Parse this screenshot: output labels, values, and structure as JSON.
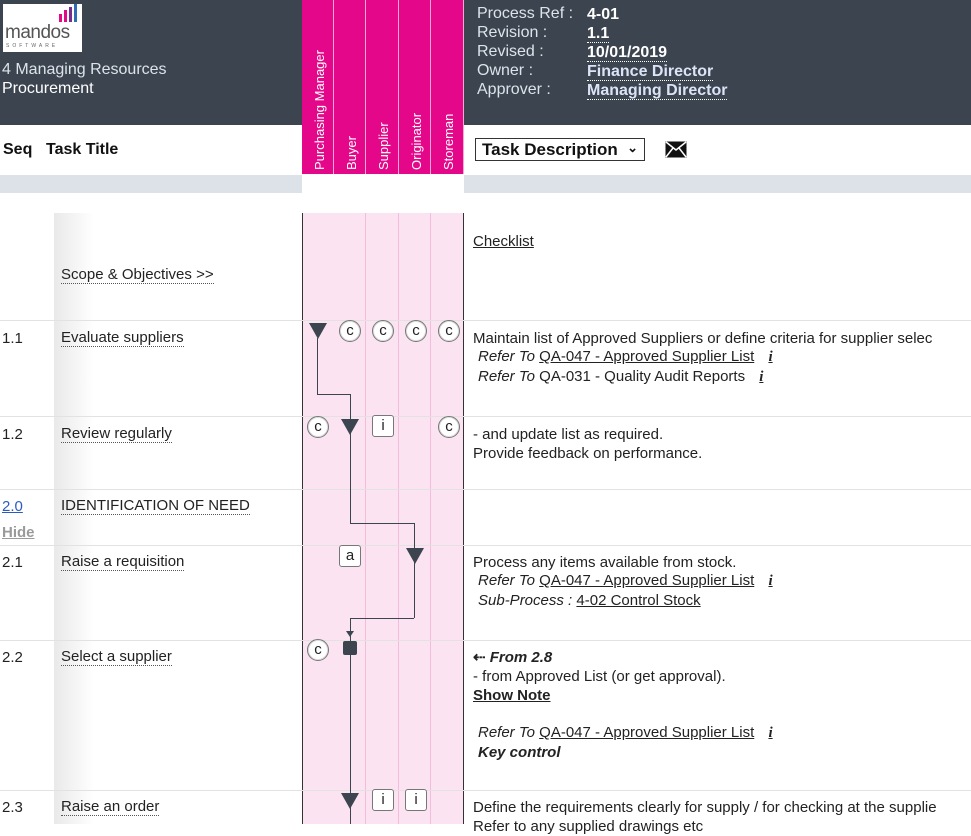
{
  "header": {
    "logo_text": "mandos",
    "logo_sub": "SOFTWARE",
    "section": "4 Managing Resources",
    "process": "Procurement",
    "meta": [
      {
        "label": "Process Ref :",
        "value": "4-01"
      },
      {
        "label": "Revision :",
        "value": "1.1"
      },
      {
        "label": "Revised :",
        "value": "10/01/2019"
      },
      {
        "label": "Owner :",
        "value": "Finance Director"
      },
      {
        "label": "Approver :",
        "value": "Managing Director"
      }
    ]
  },
  "roles": [
    "Purchasing Manager",
    "Buyer",
    "Supplier",
    "Originator",
    "Storeman"
  ],
  "columns": {
    "seq": "Seq",
    "title": "Task Title",
    "description_select": "Task Description"
  },
  "icons": {
    "mail": "mail-icon",
    "chevron": "chevron-down-icon"
  },
  "colors": {
    "role_accent": "#e4078a",
    "header_bg": "#3c4450",
    "role_bg": "#fbe3f1"
  },
  "scope": {
    "title": "Scope & Objectives >>",
    "checklist": "Checklist"
  },
  "rows": [
    {
      "seq": "1.1",
      "title": "Evaluate suppliers",
      "desc": "Maintain list of Approved Suppliers or define criteria for supplier selec",
      "refs": [
        {
          "kind": "Refer To",
          "doc": "QA-047 - Approved Supplier List",
          "info": "i"
        },
        {
          "kind": "Refer To",
          "doc": "QA-031 - Quality Audit Reports",
          "info": "i"
        }
      ],
      "markers": {
        "Purchasing Manager": "▼",
        "Buyer": "c",
        "Supplier": "c",
        "Originator": "c",
        "Storeman": "c"
      }
    },
    {
      "seq": "1.2",
      "title": "Review regularly",
      "desc": [
        "- and update list as required.",
        "Provide feedback on performance."
      ],
      "markers": {
        "Purchasing Manager": "c",
        "Buyer": "▼",
        "Supplier": "i",
        "Storeman": "c"
      }
    },
    {
      "seq": "2.0",
      "title": "IDENTIFICATION OF NEED",
      "hide_label": "Hide"
    },
    {
      "seq": "2.1",
      "title": "Raise a requisition",
      "desc": "Process any items available from stock.",
      "refs": [
        {
          "kind": "Refer To",
          "doc": "QA-047 - Approved Supplier List",
          "info": "i"
        },
        {
          "kind": "Sub-Process :",
          "doc": "4-02 Control Stock"
        }
      ],
      "markers": {
        "Buyer": "a",
        "Originator": "▼"
      }
    },
    {
      "seq": "2.2",
      "title": "Select a supplier",
      "from": "From 2.8",
      "desc": "- from Approved List (or get approval).",
      "show_note": "Show Note",
      "refs": [
        {
          "kind": "Refer To",
          "doc": "QA-047 - Approved Supplier List",
          "info": "i"
        }
      ],
      "key_control": "Key control",
      "markers": {
        "Purchasing Manager": "c",
        "Buyer": "■"
      }
    },
    {
      "seq": "2.3",
      "title": "Raise an order",
      "desc": [
        "Define the requirements clearly for supply / for checking at the supplie",
        "Refer to any supplied drawings etc"
      ],
      "markers": {
        "Buyer": "▼",
        "Supplier": "i",
        "Originator": "i"
      }
    }
  ]
}
